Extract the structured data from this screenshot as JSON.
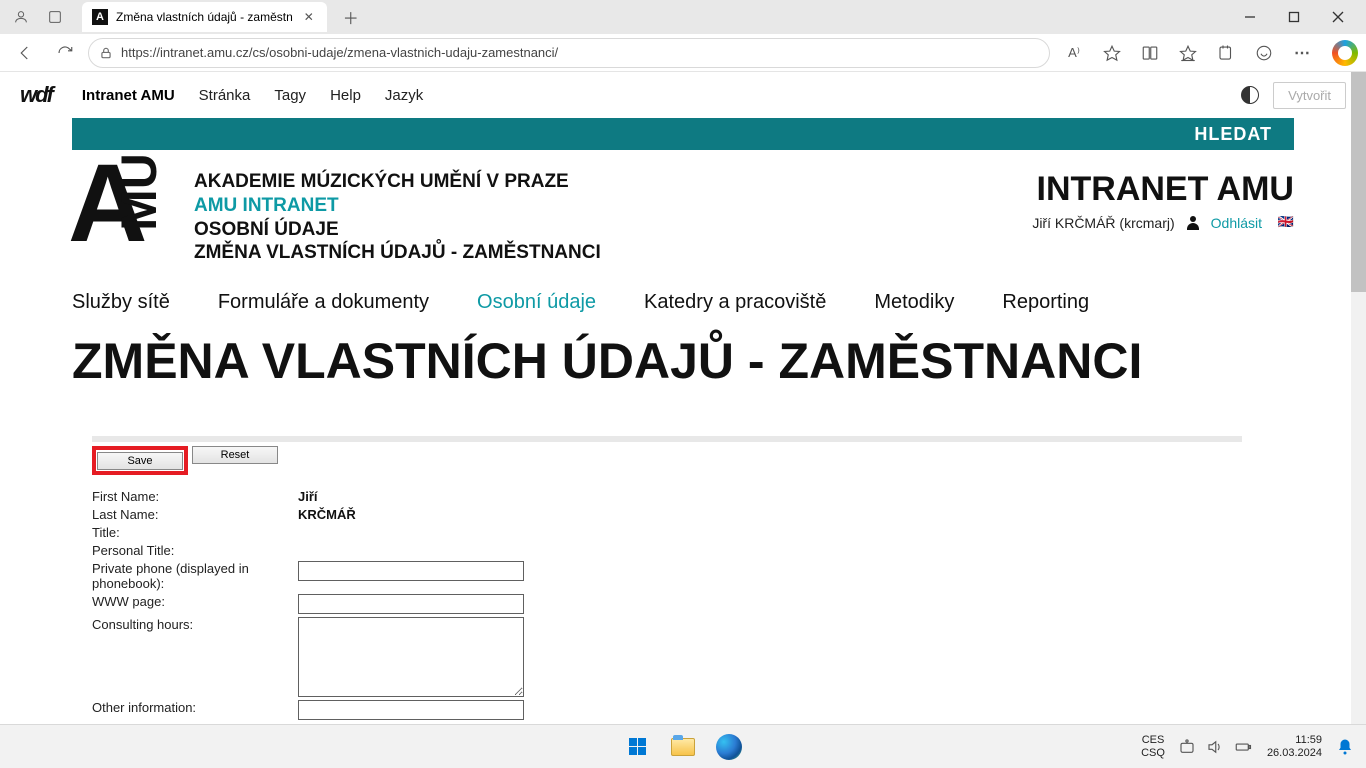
{
  "browser": {
    "tab_title": "Změna vlastních údajů - zaměstn",
    "url": "https://intranet.amu.cz/cs/osobni-udaje/zmena-vlastnich-udaju-zamestnanci/"
  },
  "topbar": {
    "brand": "Intranet AMU",
    "items": [
      "Stránka",
      "Tagy",
      "Help",
      "Jazyk"
    ],
    "create_label": "Vytvořit"
  },
  "search_label": "HLEDAT",
  "header": {
    "line1": "AKADEMIE MÚZICKÝCH UMĚNÍ V PRAZE",
    "line2": "AMU INTRANET",
    "line3": "OSOBNÍ ÚDAJE",
    "line4": "ZMĚNA VLASTNÍCH ÚDAJŮ - ZAMĚSTNANCI",
    "big_right": "INTRANET AMU",
    "user": "Jiří KRČMÁŘ (krcmarj)",
    "logout": "Odhlásit"
  },
  "main_nav": [
    "Služby sítě",
    "Formuláře a dokumenty",
    "Osobní údaje",
    "Katedry a pracoviště",
    "Metodiky",
    "Reporting"
  ],
  "main_nav_active_index": 2,
  "page_title": "ZMĚNA VLASTNÍCH ÚDAJŮ - ZAMĚSTNANCI",
  "form": {
    "save_label": "Save",
    "reset_label": "Reset",
    "first_name_label": "First Name:",
    "first_name_value": "Jiří",
    "last_name_label": "Last Name:",
    "last_name_value": "KRČMÁŘ",
    "title_label": "Title:",
    "personal_title_label": "Personal Title:",
    "private_phone_label": "Private phone (displayed in phonebook):",
    "www_label": "WWW page:",
    "consulting_label": "Consulting hours:",
    "other_info_label": "Other information:"
  },
  "taskbar": {
    "lang1": "CES",
    "lang2": "CSQ",
    "time": "11:59",
    "date": "26.03.2024"
  }
}
